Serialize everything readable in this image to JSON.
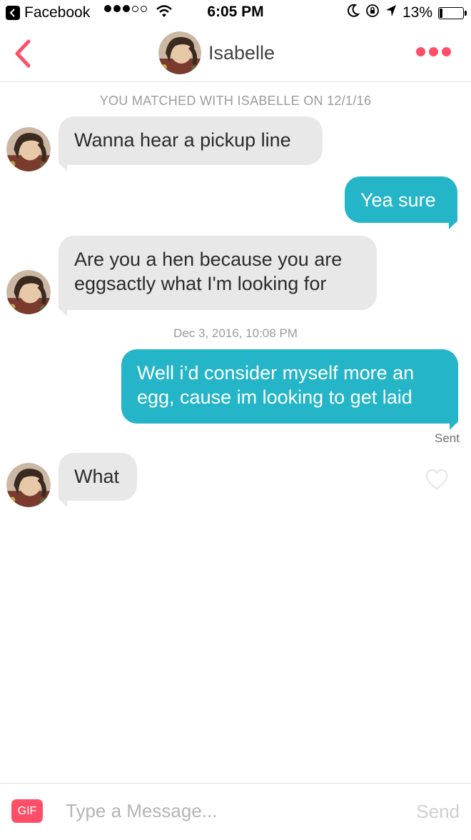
{
  "status_bar": {
    "back_app": "Facebook",
    "time": "6:05 PM",
    "battery_text": "13%",
    "battery_level": 0.13
  },
  "header": {
    "contact_name": "Isabelle"
  },
  "chat": {
    "match_notice": "YOU MATCHED WITH ISABELLE ON 12/1/16",
    "timestamp": "Dec 3, 2016, 10:08 PM",
    "messages": [
      {
        "from": "them",
        "text": "Wanna hear a pickup line"
      },
      {
        "from": "me",
        "text": "Yea sure"
      },
      {
        "from": "them",
        "text": "Are you a hen because you are eggsactly what I'm looking for"
      },
      {
        "from": "me",
        "text": "Well i’d consider myself more an egg, cause im looking to get laid"
      },
      {
        "from": "them",
        "text": "What"
      }
    ],
    "sent_status": "Sent"
  },
  "composer": {
    "gif_label": "GIF",
    "placeholder": "Type a Message...",
    "send_label": "Send"
  },
  "colors": {
    "accent": "#fd5068",
    "outgoing_bubble": "#25b5c8",
    "incoming_bubble": "#e8e8e8"
  },
  "icons": [
    "back-app-icon",
    "signal-dots-icon",
    "wifi-icon",
    "moon-icon",
    "orientation-lock-icon",
    "location-arrow-icon",
    "battery-icon",
    "back-chevron-icon",
    "more-dots-icon",
    "heart-icon"
  ]
}
